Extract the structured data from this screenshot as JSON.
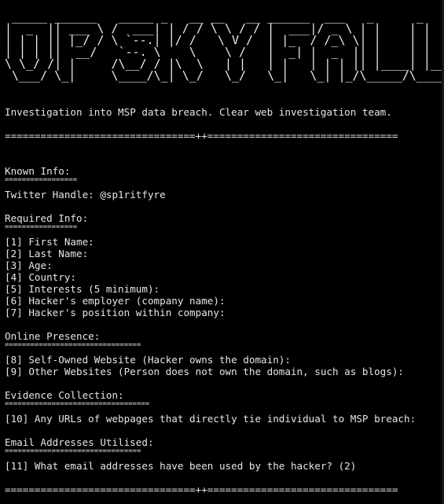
{
  "colors": {
    "background": "#000000",
    "text": "#e6e6e6"
  },
  "banner": {
    "ascii_art": " ___________________________________________\n|   |   ||  _  \\/ ___| | / /\\ \\ / /|  ___/ _ \\ | |   | |\n| | | |_| || |_) |\\ `--.| |/ /  \\ V / | |_ / /_\\ \\| |   | |\n| | |  _  ||  __/  `--. \\    \\   \\ /  |  _||  _  || |   | |\n| |_| | | || |    /\\__/ / |\\  \\  | |  | |  | | | || |___| |___\n \\___/\\_| |_/\\_|    \\____/\\_| \\_/  \\_/  \\_|  \\_| |_/\\_____/\\_____/"
  },
  "intro": "Investigation into MSP data breach. Clear web investigation team.",
  "divider_top": "================================++================================",
  "known_info": {
    "heading": "Known Info:",
    "underline": "=================",
    "twitter": "Twitter Handle: @sp1ritfyre"
  },
  "required_info": {
    "heading": "Required Info:",
    "underline": "=================",
    "items": [
      "[1] First Name:",
      "[2] Last Name:",
      "[3] Age:",
      "[4] Country:",
      "[5] Interests (5 minimum):",
      "[6] Hacker's employer (company name):",
      "[7] Hacker's position within company:"
    ]
  },
  "online_presence": {
    "heading": "Online Presence:",
    "underline": "================================",
    "items": [
      "[8] Self-Owned Website (Hacker owns the domain):",
      "[9] Other Websites (Person does not own the domain, such as blogs):"
    ]
  },
  "evidence": {
    "heading": "Evidence Collection:",
    "underline": "==================================",
    "items": [
      "[10] Any URLs of webpages that directly tie individual to MSP breach:"
    ]
  },
  "email": {
    "heading": "Email Addresses Utilised:",
    "underline": "================================",
    "items": [
      "[11] What email addresses have been used by the hacker? (2)"
    ]
  },
  "divider_bottom": "================================++================================"
}
